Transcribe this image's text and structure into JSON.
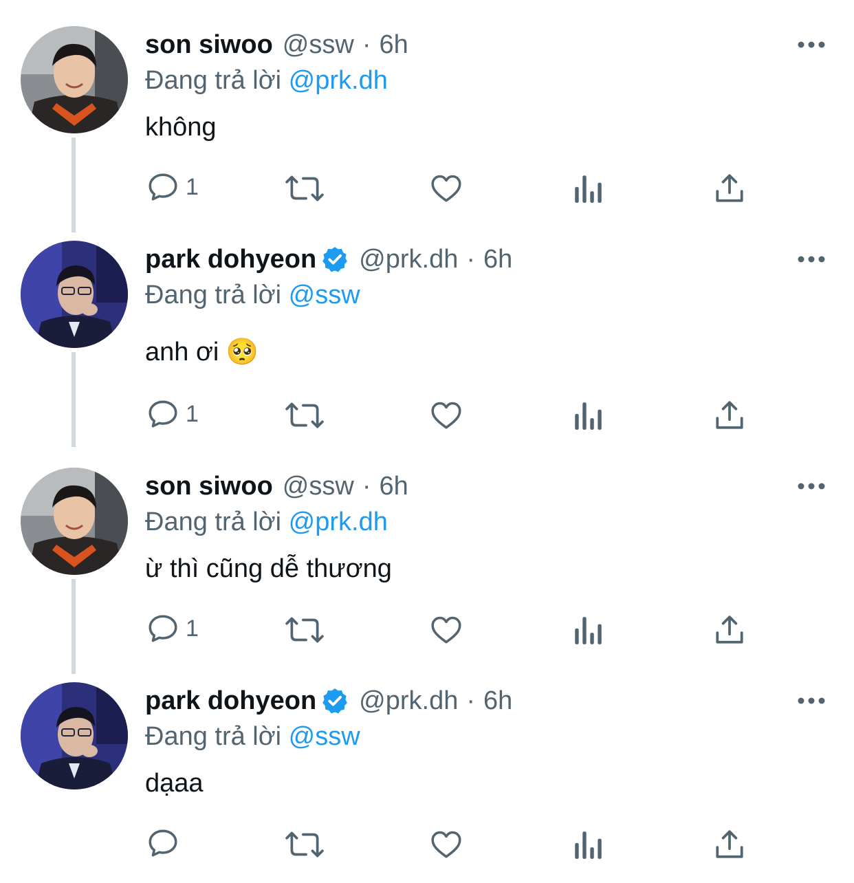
{
  "colors": {
    "primary_text": "#0f1419",
    "secondary_text": "#536471",
    "link": "#1d9bf0",
    "thread_line": "#cfd9de",
    "icon": "#536471"
  },
  "icons": {
    "reply": "speech-bubble",
    "retweet": "retweet-arrows",
    "like": "heart",
    "views": "bar-chart",
    "share": "share-upload",
    "more": "three-dots",
    "verified": "blue-verified-badge"
  },
  "tweets": [
    {
      "display_name": "son siwoo",
      "handle": "@ssw",
      "separator": "·",
      "time": "6h",
      "verified": false,
      "reply_prefix": "Đang trả lời",
      "reply_to": "@prk.dh",
      "text": "không",
      "reply_count": "1"
    },
    {
      "display_name": "park dohyeon",
      "handle": "@prk.dh",
      "separator": "·",
      "time": "6h",
      "verified": true,
      "reply_prefix": "Đang trả lời",
      "reply_to": "@ssw",
      "text": "anh ơi 🥺",
      "reply_count": "1"
    },
    {
      "display_name": "son siwoo",
      "handle": "@ssw",
      "separator": "·",
      "time": "6h",
      "verified": false,
      "reply_prefix": "Đang trả lời",
      "reply_to": "@prk.dh",
      "text": "ừ thì cũng dễ thương",
      "reply_count": "1"
    },
    {
      "display_name": "park dohyeon",
      "handle": "@prk.dh",
      "separator": "·",
      "time": "6h",
      "verified": true,
      "reply_prefix": "Đang trả lời",
      "reply_to": "@ssw",
      "text": "dạaa",
      "reply_count": ""
    }
  ]
}
